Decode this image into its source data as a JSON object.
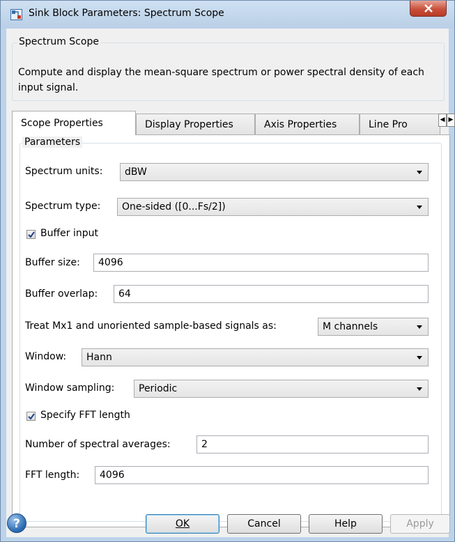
{
  "window": {
    "title": "Sink Block Parameters: Spectrum Scope"
  },
  "block": {
    "group_title": "Spectrum Scope",
    "description": "Compute and display the mean-square spectrum or power spectral density of each input signal."
  },
  "tabs": [
    {
      "label": "Scope Properties",
      "active": true
    },
    {
      "label": "Display Properties",
      "active": false
    },
    {
      "label": "Axis Properties",
      "active": false
    },
    {
      "label": "Line Pro",
      "active": false
    }
  ],
  "parameters": {
    "group_title": "Parameters",
    "spectrum_units": {
      "label": "Spectrum units:",
      "value": "dBW"
    },
    "spectrum_type": {
      "label": "Spectrum type:",
      "value": "One-sided ([0...Fs/2])"
    },
    "buffer_input": {
      "label": "Buffer input",
      "checked": true
    },
    "buffer_size": {
      "label": "Buffer size:",
      "value": "4096"
    },
    "buffer_overlap": {
      "label": "Buffer overlap:",
      "value": "64"
    },
    "treat_signals": {
      "label": "Treat Mx1 and unoriented sample-based signals as:",
      "value": "M channels"
    },
    "window": {
      "label": "Window:",
      "value": "Hann"
    },
    "window_sampling": {
      "label": "Window sampling:",
      "value": "Periodic"
    },
    "specify_fft_length": {
      "label": "Specify FFT length",
      "checked": true
    },
    "spectral_averages": {
      "label": "Number of spectral averages:",
      "value": "2"
    },
    "fft_length": {
      "label": "FFT length:",
      "value": "4096"
    }
  },
  "buttons": {
    "ok": "OK",
    "cancel": "Cancel",
    "help": "Help",
    "apply": "Apply"
  }
}
